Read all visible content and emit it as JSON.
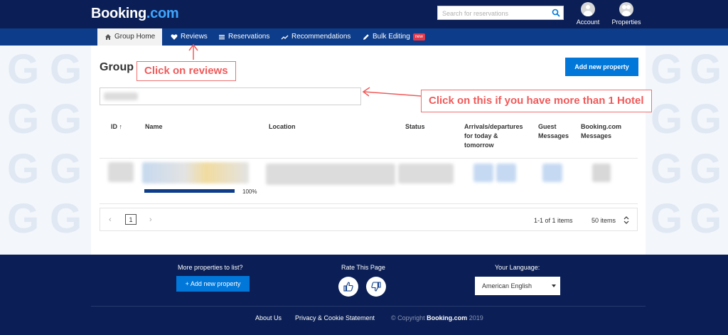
{
  "header": {
    "logo_main": "Booking",
    "logo_suffix": ".com",
    "search_placeholder": "Search for reservations",
    "account_label": "Account",
    "properties_label": "Properties",
    "icons": [
      "search-icon",
      "account-icon",
      "properties-icon"
    ]
  },
  "nav": {
    "items": [
      {
        "label": "Group Home",
        "icon": "home-icon"
      },
      {
        "label": "Reviews",
        "icon": "heart-icon"
      },
      {
        "label": "Reservations",
        "icon": "list-icon"
      },
      {
        "label": "Recommendations",
        "icon": "trend-icon"
      },
      {
        "label": "Bulk Editing",
        "icon": "pencil-icon",
        "badge": "new"
      }
    ]
  },
  "main": {
    "title": "Group",
    "add_property_label": "Add new property",
    "annotations": {
      "reviews": "Click on reviews",
      "hotel": "Click on this if you have more than 1 Hotel"
    },
    "table": {
      "headers": {
        "id": "ID ↑",
        "name": "Name",
        "location": "Location",
        "status": "Status",
        "arrivals": "Arrivals/departures for today & tomorrow",
        "guest_messages": "Guest Messages",
        "booking_messages": "Booking.com Messages"
      },
      "row": {
        "progress_label": "100%",
        "progress_value": 100
      }
    },
    "pagination": {
      "prev": "‹",
      "page": "1",
      "next": "›",
      "range": "1-1 of 1 items",
      "per_page": "50 items"
    }
  },
  "footer": {
    "more_properties": "More properties to list?",
    "add_property_label": "+ Add new property",
    "rate_page": "Rate This Page",
    "language_label": "Your Language:",
    "language_value": "American English",
    "links": {
      "about": "About Us",
      "privacy": "Privacy & Cookie Statement",
      "copyright_prefix": "© Copyright",
      "copyright_brand": "Booking.com",
      "copyright_year": "2019"
    }
  },
  "colors": {
    "header_bg": "#0b1f56",
    "nav_bg": "#0c3c8a",
    "accent_button": "#0077d9",
    "annotation": "#f05a5a",
    "badge": "#e0394c"
  }
}
